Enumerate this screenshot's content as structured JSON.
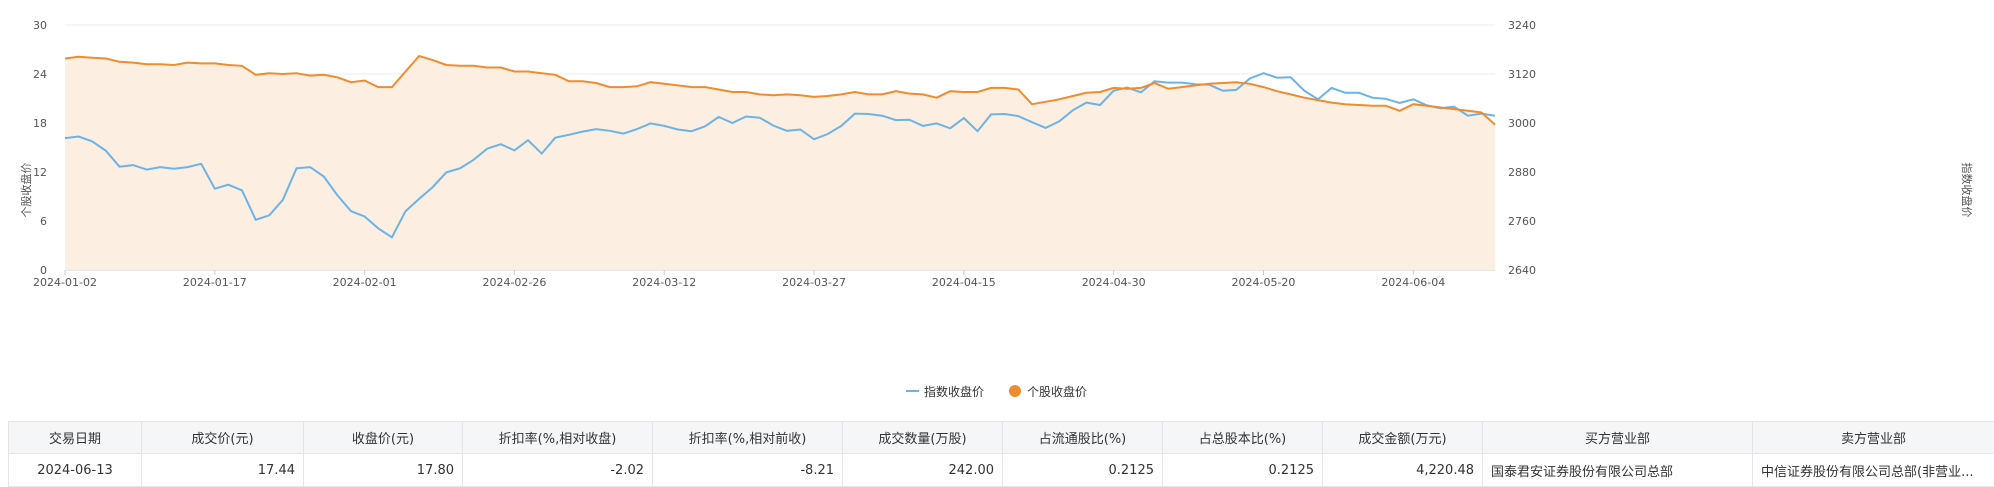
{
  "chart_data": {
    "type": "line",
    "x": [
      "2024-01-02",
      "2024-01-03",
      "2024-01-04",
      "2024-01-05",
      "2024-01-08",
      "2024-01-09",
      "2024-01-10",
      "2024-01-11",
      "2024-01-12",
      "2024-01-15",
      "2024-01-16",
      "2024-01-17",
      "2024-01-18",
      "2024-01-19",
      "2024-01-22",
      "2024-01-23",
      "2024-01-24",
      "2024-01-25",
      "2024-01-26",
      "2024-01-29",
      "2024-01-30",
      "2024-01-31",
      "2024-02-01",
      "2024-02-02",
      "2024-02-05",
      "2024-02-06",
      "2024-02-07",
      "2024-02-08",
      "2024-02-19",
      "2024-02-20",
      "2024-02-21",
      "2024-02-22",
      "2024-02-23",
      "2024-02-26",
      "2024-02-27",
      "2024-02-28",
      "2024-02-29",
      "2024-03-01",
      "2024-03-04",
      "2024-03-05",
      "2024-03-06",
      "2024-03-07",
      "2024-03-08",
      "2024-03-11",
      "2024-03-12",
      "2024-03-13",
      "2024-03-14",
      "2024-03-15",
      "2024-03-18",
      "2024-03-19",
      "2024-03-20",
      "2024-03-21",
      "2024-03-22",
      "2024-03-25",
      "2024-03-26",
      "2024-03-27",
      "2024-03-28",
      "2024-03-29",
      "2024-04-01",
      "2024-04-02",
      "2024-04-03",
      "2024-04-08",
      "2024-04-09",
      "2024-04-10",
      "2024-04-11",
      "2024-04-12",
      "2024-04-15",
      "2024-04-16",
      "2024-04-17",
      "2024-04-18",
      "2024-04-19",
      "2024-04-22",
      "2024-04-23",
      "2024-04-24",
      "2024-04-25",
      "2024-04-26",
      "2024-04-29",
      "2024-04-30",
      "2024-05-06",
      "2024-05-07",
      "2024-05-08",
      "2024-05-09",
      "2024-05-10",
      "2024-05-13",
      "2024-05-14",
      "2024-05-15",
      "2024-05-16",
      "2024-05-17",
      "2024-05-20",
      "2024-05-21",
      "2024-05-22",
      "2024-05-23",
      "2024-05-24",
      "2024-05-27",
      "2024-05-28",
      "2024-05-29",
      "2024-05-30",
      "2024-05-31",
      "2024-06-03",
      "2024-06-04",
      "2024-06-05",
      "2024-06-06",
      "2024-06-07",
      "2024-06-11",
      "2024-06-12",
      "2024-06-13"
    ],
    "x_ticks": [
      "2024-01-02",
      "2024-01-17",
      "2024-02-01",
      "2024-02-26",
      "2024-03-12",
      "2024-03-27",
      "2024-04-15",
      "2024-04-30",
      "2024-05-20",
      "2024-06-04"
    ],
    "series": [
      {
        "name": "指数收盘价",
        "axis": "right",
        "color": "#6cb3e6",
        "values": [
          2963,
          2967,
          2955,
          2932,
          2893,
          2897,
          2886,
          2892,
          2888,
          2892,
          2900,
          2839,
          2849,
          2835,
          2763,
          2774,
          2812,
          2889,
          2892,
          2869,
          2823,
          2784,
          2771,
          2742,
          2720,
          2784,
          2814,
          2843,
          2879,
          2889,
          2910,
          2937,
          2948,
          2933,
          2958,
          2925,
          2964,
          2971,
          2979,
          2985,
          2981,
          2974,
          2985,
          2999,
          2993,
          2984,
          2980,
          2992,
          3015,
          3000,
          3016,
          3013,
          2994,
          2981,
          2984,
          2960,
          2973,
          2993,
          3023,
          3022,
          3018,
          3007,
          3008,
          2993,
          2999,
          2987,
          3012,
          2980,
          3021,
          3022,
          3017,
          3002,
          2988,
          3004,
          3031,
          3050,
          3044,
          3079,
          3087,
          3075,
          3102,
          3099,
          3099,
          3095,
          3094,
          3079,
          3081,
          3109,
          3122,
          3111,
          3112,
          3079,
          3058,
          3086,
          3074,
          3074,
          3062,
          3059,
          3049,
          3058,
          3043,
          3036,
          3040,
          3018,
          3023,
          3018
        ],
        "wait": true
      },
      {
        "name": "个股收盘价",
        "axis": "left",
        "color": "#f08c2e",
        "fill": "#fdeee2",
        "values": [
          25.9,
          26.1,
          26.0,
          25.9,
          25.5,
          25.4,
          25.2,
          25.2,
          25.1,
          25.4,
          25.3,
          25.3,
          25.1,
          25.0,
          23.9,
          24.1,
          24.0,
          24.1,
          23.8,
          23.9,
          23.6,
          23.0,
          23.2,
          22.4,
          22.4,
          24.3,
          26.2,
          25.7,
          25.1,
          25.0,
          25.0,
          24.8,
          24.8,
          24.3,
          24.3,
          24.1,
          23.9,
          23.1,
          23.1,
          22.9,
          22.4,
          22.4,
          22.5,
          23.0,
          22.8,
          22.6,
          22.4,
          22.4,
          22.1,
          21.8,
          21.8,
          21.5,
          21.4,
          21.5,
          21.4,
          21.2,
          21.3,
          21.5,
          21.8,
          21.5,
          21.5,
          21.9,
          21.6,
          21.5,
          21.1,
          21.9,
          21.8,
          21.8,
          22.3,
          22.3,
          22.1,
          20.3,
          20.6,
          20.9,
          21.3,
          21.7,
          21.8,
          22.3,
          22.2,
          22.3,
          22.9,
          22.2,
          22.4,
          22.6,
          22.8,
          22.9,
          23.0,
          22.8,
          22.4,
          21.9,
          21.5,
          21.1,
          20.8,
          20.5,
          20.3,
          20.2,
          20.1,
          20.1,
          19.5,
          20.3,
          20.1,
          19.9,
          19.7,
          19.5,
          19.3,
          17.8
        ]
      }
    ],
    "left_axis": {
      "label": "个股收盘价",
      "ticks": [
        0,
        6,
        12,
        18,
        24,
        30
      ],
      "ylim": [
        0,
        30
      ]
    },
    "right_axis": {
      "label": "指数收盘价",
      "ticks": [
        2640,
        2760,
        2880,
        3000,
        3120,
        3240
      ],
      "ylim": [
        2640,
        3240
      ]
    },
    "legend": {
      "placement": "bottom-center",
      "items": [
        "指数收盘价",
        "个股收盘价"
      ]
    },
    "grid": true
  },
  "table": {
    "headers": [
      "交易日期",
      "成交价(元)",
      "收盘价(元)",
      "折扣率(%,相对收盘)",
      "折扣率(%,相对前收)",
      "成交数量(万股)",
      "占流通股比(%)",
      "占总股本比(%)",
      "成交金额(万元)",
      "买方营业部",
      "卖方营业部"
    ],
    "rows": [
      [
        "2024-06-13",
        "17.44",
        "17.80",
        "-2.02",
        "-8.21",
        "242.00",
        "0.2125",
        "0.2125",
        "4,220.48",
        "国泰君安证券股份有限公司总部",
        "中信证券股份有限公司总部(非营业..."
      ]
    ]
  }
}
